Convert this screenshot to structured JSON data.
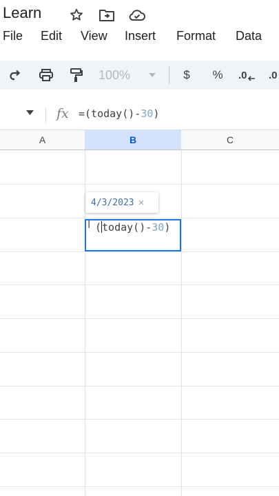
{
  "app": {
    "title": "Learn",
    "title_icons": [
      "star-icon",
      "move-to-folder-icon",
      "cloud-status-icon"
    ]
  },
  "menu": {
    "items": [
      "File",
      "Edit",
      "View",
      "Insert",
      "Format",
      "Data"
    ]
  },
  "toolbar": {
    "zoom": "100%",
    "currency_label": "$",
    "percent_label": "%",
    "decrease_decimal_label": ".0",
    "increase_decimal_label": ".0"
  },
  "formula_bar": {
    "fx_label": "fx",
    "formula_prefix": "=(today()-",
    "formula_number": "30",
    "formula_suffix": ")"
  },
  "columns": [
    "A",
    "B",
    "C"
  ],
  "selected_column": "B",
  "tooltip": {
    "value": "4/3/2023",
    "close": "×"
  },
  "active_cell": {
    "lead": "(",
    "text_before_number": "today()-",
    "number": "30",
    "close_paren": ")"
  },
  "colors": {
    "selection_blue": "#1a73e8",
    "column_header_selected": "#d3e3fd",
    "toolbar_bg": "#f0f4f9",
    "formula_number": "#7fa7c9"
  }
}
